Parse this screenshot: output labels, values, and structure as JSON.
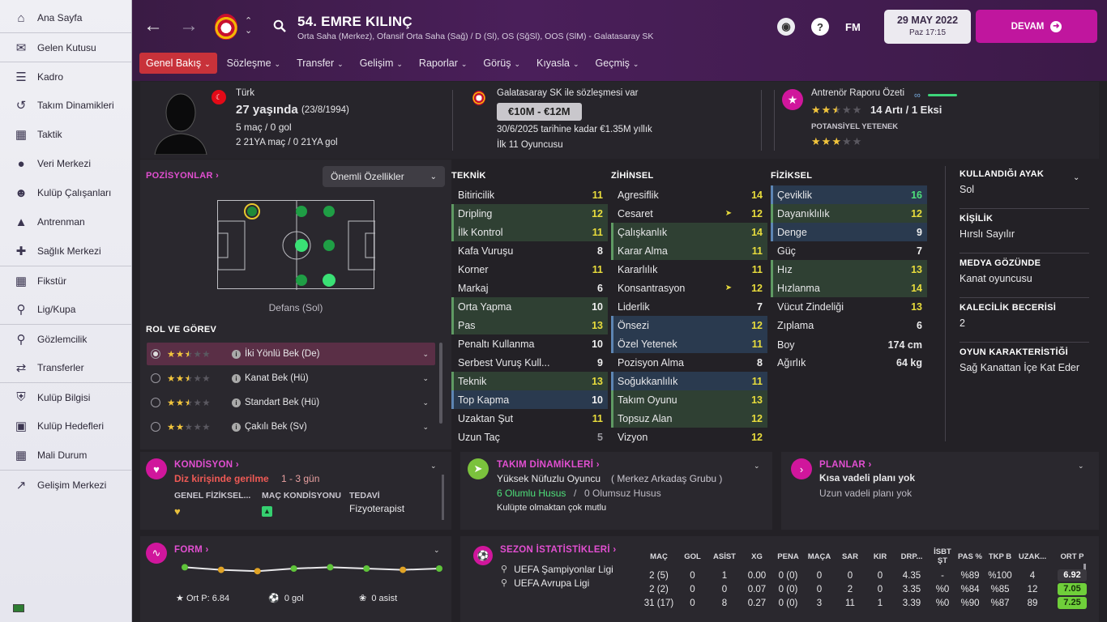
{
  "sidebar": {
    "items": [
      {
        "label": "Ana Sayfa",
        "icon": "home-icon"
      },
      {
        "label": "Gelen Kutusu",
        "icon": "inbox-icon"
      },
      {
        "label": "Kadro",
        "icon": "squad-icon"
      },
      {
        "label": "Takım Dinamikleri",
        "icon": "dynamics-icon"
      },
      {
        "label": "Taktik",
        "icon": "tactics-icon"
      },
      {
        "label": "Veri Merkezi",
        "icon": "data-icon"
      },
      {
        "label": "Kulüp Çalışanları",
        "icon": "staff-icon"
      },
      {
        "label": "Antrenman",
        "icon": "training-icon"
      },
      {
        "label": "Sağlık Merkezi",
        "icon": "medical-icon"
      },
      {
        "label": "Fikstür",
        "icon": "calendar-icon"
      },
      {
        "label": "Lig/Kupa",
        "icon": "trophy-icon"
      },
      {
        "label": "Gözlemcilik",
        "icon": "scouting-icon"
      },
      {
        "label": "Transferler",
        "icon": "transfer-icon"
      },
      {
        "label": "Kulüp Bilgisi",
        "icon": "club-shield-icon"
      },
      {
        "label": "Kulüp Hedefleri",
        "icon": "briefcase-icon"
      },
      {
        "label": "Mali Durum",
        "icon": "finance-icon"
      },
      {
        "label": "Gelişim Merkezi",
        "icon": "development-icon"
      }
    ]
  },
  "header": {
    "player_name": "54. EMRE KILINÇ",
    "positions": "Orta Saha (Merkez), Ofansif Orta Saha (Sağ) / D (Sl), OS (SğSl), OOS (SlM) - Galatasaray SK",
    "fm": "FM",
    "date": "29 MAY 2022",
    "day": "Paz 17:15",
    "continue": "DEVAM"
  },
  "tabs": [
    "Genel Bakış",
    "Sözleşme",
    "Transfer",
    "Gelişim",
    "Raporlar",
    "Görüş",
    "Kıyasla",
    "Geçmiş"
  ],
  "info": {
    "nationality": "Türk",
    "age": "27 yaşında",
    "dob": "(23/8/1994)",
    "caps": "5 maç / 0 gol",
    "u21": "2 21YA maç / 0 21YA gol",
    "contract": "Galatasaray SK ile sözleşmesi var",
    "value": "€10M - €12M",
    "wage": "30/6/2025 tarihine kadar €1.35M yıllık",
    "squad_status": "İlk 11 Oyuncusu",
    "report_title": "Antrenör Raporu Özeti",
    "report_sum": "14 Artı / 1 Eksi",
    "potential_label": "POTANSİYEL YETENEK",
    "ability_stars": 2.5,
    "potential_stars": 3
  },
  "positions": {
    "title": "POZİSYONLAR",
    "dropdown": "Önemli Özellikler",
    "position_label": "Defans (Sol)",
    "role_title": "ROL VE GÖREV"
  },
  "roles": [
    {
      "name": "İki Yönlü Bek (De)",
      "stars": 2.5
    },
    {
      "name": "Kanat Bek (Hü)",
      "stars": 2.5
    },
    {
      "name": "Standart Bek (Hü)",
      "stars": 2.5
    },
    {
      "name": "Çakılı Bek (Sv)",
      "stars": 2
    }
  ],
  "attributes": {
    "technical_title": "TEKNİK",
    "mental_title": "ZİHİNSEL",
    "physical_title": "FİZİKSEL",
    "technical": [
      {
        "name": "Bitiricilik",
        "value": "11"
      },
      {
        "name": "Dripling",
        "value": "12"
      },
      {
        "name": "İlk Kontrol",
        "value": "11"
      },
      {
        "name": "Kafa Vuruşu",
        "value": "8"
      },
      {
        "name": "Korner",
        "value": "11"
      },
      {
        "name": "Markaj",
        "value": "6"
      },
      {
        "name": "Orta Yapma",
        "value": "10"
      },
      {
        "name": "Pas",
        "value": "13"
      },
      {
        "name": "Penaltı Kullanma",
        "value": "10"
      },
      {
        "name": "Serbest Vuruş Kull...",
        "value": "9"
      },
      {
        "name": "Teknik",
        "value": "13"
      },
      {
        "name": "Top Kapma",
        "value": "10"
      },
      {
        "name": "Uzaktan Şut",
        "value": "11"
      },
      {
        "name": "Uzun Taç",
        "value": "5"
      }
    ],
    "mental": [
      {
        "name": "Agresiflik",
        "value": "14"
      },
      {
        "name": "Cesaret",
        "value": "12"
      },
      {
        "name": "Çalışkanlık",
        "value": "14"
      },
      {
        "name": "Karar Alma",
        "value": "11"
      },
      {
        "name": "Kararlılık",
        "value": "11"
      },
      {
        "name": "Konsantrasyon",
        "value": "12"
      },
      {
        "name": "Liderlik",
        "value": "7"
      },
      {
        "name": "Önsezi",
        "value": "12"
      },
      {
        "name": "Özel Yetenek",
        "value": "11"
      },
      {
        "name": "Pozisyon Alma",
        "value": "8"
      },
      {
        "name": "Soğukkanlılık",
        "value": "11"
      },
      {
        "name": "Takım Oyunu",
        "value": "13"
      },
      {
        "name": "Topsuz Alan",
        "value": "12"
      },
      {
        "name": "Vizyon",
        "value": "12"
      }
    ],
    "physical": [
      {
        "name": "Çeviklik",
        "value": "16"
      },
      {
        "name": "Dayanıklılık",
        "value": "12"
      },
      {
        "name": "Denge",
        "value": "9"
      },
      {
        "name": "Güç",
        "value": "7"
      },
      {
        "name": "Hız",
        "value": "13"
      },
      {
        "name": "Hızlanma",
        "value": "14"
      },
      {
        "name": "Vücut Zindeliği",
        "value": "13"
      },
      {
        "name": "Zıplama",
        "value": "6"
      }
    ],
    "height_label": "Boy",
    "height": "174 cm",
    "weight_label": "Ağırlık",
    "weight": "64 kg"
  },
  "right": [
    {
      "k": "KULLANDIĞI AYAK",
      "v": "Sol"
    },
    {
      "k": "KİŞİLİK",
      "v": "Hırslı Sayılır"
    },
    {
      "k": "MEDYA GÖZÜNDE",
      "v": "Kanat oyuncusu"
    },
    {
      "k": "KALECİLİK BECERİSİ",
      "v": "2"
    },
    {
      "k": "OYUN KARAKTERİSTİĞİ",
      "v": "Sağ Kanattan İçe Kat Eder"
    }
  ],
  "condition": {
    "title": "KONDİSYON",
    "injury": "Diz kirişinde gerilme",
    "duration": "1 - 3 gün",
    "l1": "GENEL FİZİKSEL...",
    "l2": "MAÇ KONDİSYONU",
    "l3": "TEDAVİ",
    "treatment": "Fizyoterapist"
  },
  "dynamics": {
    "title": "TAKIM DİNAMİKLERİ",
    "status": "Yüksek Nüfuzlu Oyuncu",
    "group": "( Merkez Arkadaş Grubu )",
    "pos": "6 Olumlu Husus",
    "sep": "/",
    "neg": "0 Olumsuz Husus",
    "mood": "Kulüpte olmaktan çok mutlu"
  },
  "plans": {
    "title": "PLANLAR",
    "short": "Kısa vadeli planı yok",
    "long": "Uzun vadeli planı yok"
  },
  "form": {
    "title": "FORM",
    "avg": "Ort P: 6.84",
    "goals": "0 gol",
    "assists": "0 asist",
    "ratings": [
      7.1,
      6.9,
      6.8,
      7.0,
      7.1,
      7.0,
      6.9,
      7.0
    ]
  },
  "season": {
    "title": "SEZON İSTATİSTİKLERİ",
    "headers": [
      "MAÇ",
      "GOL",
      "ASİST",
      "XG",
      "PENA",
      "MAÇA",
      "SAR",
      "KIR",
      "DRP...",
      "İSBT ŞT",
      "PAS %",
      "TKP B",
      "UZAK...",
      "ORT P"
    ],
    "rows": [
      {
        "comp": "UEFA Şampiyonlar Ligi",
        "cells": [
          "2 (5)",
          "0",
          "1",
          "0.00",
          "0 (0)",
          "0",
          "0",
          "0",
          "4.35",
          "-",
          "%89",
          "%100",
          "4"
        ],
        "rating": "6.92"
      },
      {
        "comp": "UEFA Avrupa Ligi",
        "cells": [
          "2 (2)",
          "0",
          "0",
          "0.07",
          "0 (0)",
          "0",
          "2",
          "0",
          "3.35",
          "%0",
          "%84",
          "%85",
          "12"
        ],
        "rating": "7.05"
      },
      {
        "comp": "",
        "cells": [
          "31 (17)",
          "0",
          "8",
          "0.27",
          "0 (0)",
          "3",
          "11",
          "1",
          "3.39",
          "%0",
          "%90",
          "%87",
          "89"
        ],
        "rating": "7.25"
      }
    ]
  }
}
